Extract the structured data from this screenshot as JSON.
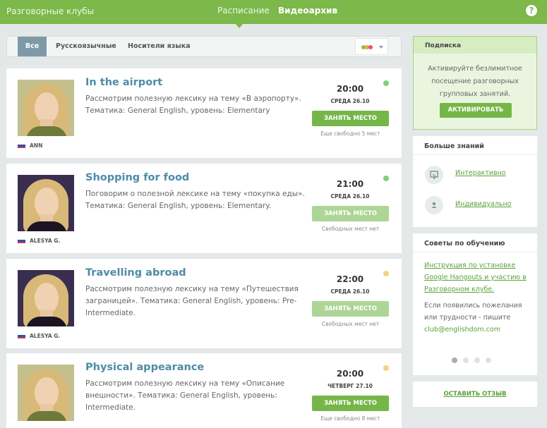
{
  "header": {
    "brand": "Разговорные клубы",
    "nav": [
      {
        "label": "Расписание",
        "active": true
      },
      {
        "label": "Видеоархив",
        "active": false
      }
    ],
    "help_label": "?"
  },
  "filters": {
    "tabs": [
      {
        "label": "Все",
        "active": true
      },
      {
        "label": "Русскоязычные",
        "active": false
      },
      {
        "label": "Носители языка",
        "active": false
      }
    ],
    "color_dots": [
      "#7cc352",
      "#f0a140",
      "#e8566a"
    ]
  },
  "lessons": [
    {
      "title": "In the airport",
      "description": "Рассмотрим полезную лексику на тему «В аэропорту». Тематика: General English, уровень: Elementary",
      "time": "20:00",
      "date": "СРЕДА  26.10",
      "button": "ЗАНЯТЬ МЕСТО",
      "button_enabled": true,
      "availability": "Еще свободно 5 мест",
      "status_color": "#7dd17e",
      "teacher": "ANN",
      "photo_bg": "#c3c08e",
      "photo_shirt": "#6e7a3a"
    },
    {
      "title": "Shopping for food",
      "description": "Поговорим о полезной лексике на тему «покупка еды». Тематика: General English, уровень: Elementary.",
      "time": "21:00",
      "date": "СРЕДА  26.10",
      "button": "ЗАНЯТЬ МЕСТО",
      "button_enabled": false,
      "availability": "Свободных мест нет",
      "status_color": "#7dd17e",
      "teacher": "ALESYA G.",
      "photo_bg": "#3a2e50",
      "photo_shirt": "#1b1423"
    },
    {
      "title": "Travelling abroad",
      "description": "Рассмотрим полезную лексику на тему «Путешествия заграницей». Тематика: General English, уровень: Pre-Intermediate.",
      "time": "22:00",
      "date": "СРЕДА  26.10",
      "button": "ЗАНЯТЬ МЕСТО",
      "button_enabled": false,
      "availability": "Свободных мест нет",
      "status_color": "#f4d37a",
      "teacher": "ALESYA G.",
      "photo_bg": "#3a2e50",
      "photo_shirt": "#1b1423"
    },
    {
      "title": "Physical appearance",
      "description": "Рассмотрим полезную лексику на тему «Описание внешности». Тематика: General English, уровень: Intermediate.",
      "time": "20:00",
      "date": "ЧЕТВЕРГ  27.10",
      "button": "ЗАНЯТЬ МЕСТО",
      "button_enabled": true,
      "availability": "Еще свободно 8 мест",
      "status_color": "#f4d37a",
      "teacher": "ANN",
      "photo_bg": "#c3c08e",
      "photo_shirt": "#6e7a3a"
    }
  ],
  "subscription": {
    "title": "Подписка",
    "text": "Активируйте безлимитное посещение разговорных групповых занятий.",
    "button": "АКТИВИРОВАТЬ"
  },
  "knowledge": {
    "title": "Больше знаний",
    "items": [
      {
        "label": "Интерактивно",
        "icon": "presentation-icon"
      },
      {
        "label": "Индивидуально",
        "icon": "person-icon"
      }
    ]
  },
  "tips": {
    "title": "Советы по обучению",
    "link": "Инструкция по установке Google Hangouts и участию в Разговорном клубе.",
    "text": "Если появились пожелания или трудности - пишите",
    "email": "club@englishdom.com",
    "dots_total": 4,
    "dots_active": 1
  },
  "review": {
    "label": "ОСТАВИТЬ ОТЗЫВ"
  }
}
